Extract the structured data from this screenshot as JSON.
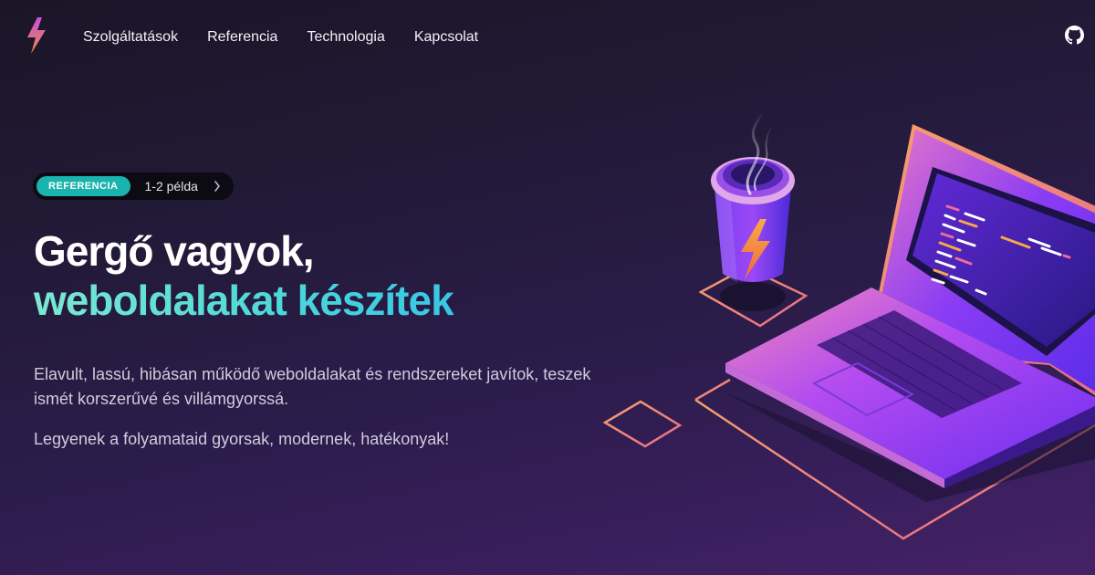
{
  "header": {
    "logo_icon": "lightning-bolt-icon",
    "nav": [
      {
        "label": "Szolgáltatások"
      },
      {
        "label": "Referencia"
      },
      {
        "label": "Technologia"
      },
      {
        "label": "Kapcsolat"
      }
    ],
    "github_icon": "github-icon"
  },
  "hero": {
    "badge": {
      "tag": "REFERENCIA",
      "text": "1-2 példa",
      "icon": "chevron-right-icon"
    },
    "title_line1": "Gergő vagyok,",
    "title_line2": "weboldalakat készítek",
    "paragraph1": "Elavult, lassú, hibásan működő weboldalakat és rendszereket javítok, teszek ismét korszerűvé és villámgyorssá.",
    "paragraph2": "Legyenek a folyamataid gyorsak, modernek, hatékonyak!"
  },
  "illustration": {
    "name": "laptop-coffee-illustration"
  },
  "colors": {
    "accent_teal": "#1bb3ad",
    "gradient_text_start": "#7ce8d2",
    "gradient_text_end": "#38c6e4",
    "background": "#211a36"
  }
}
